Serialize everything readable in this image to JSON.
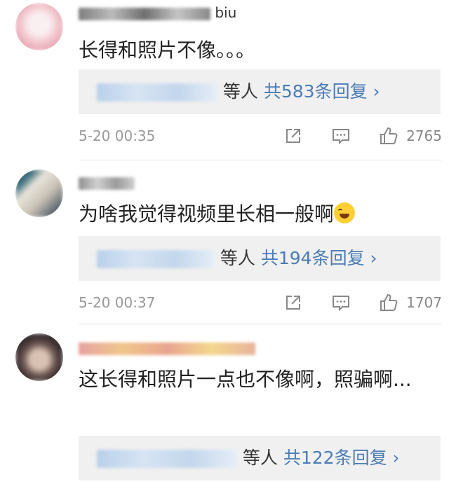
{
  "comments": [
    {
      "username_visible": "biu",
      "text": "长得和照片不像。。。",
      "replies_suffix": "等人",
      "replies_count": "共583条回复 ›",
      "time": "5-20 00:35",
      "likes": "2765"
    },
    {
      "username_visible": "",
      "text": "为啥我觉得视频里长相一般啊",
      "replies_suffix": "等人",
      "replies_count": "共194条回复 ›",
      "time": "5-20 00:37",
      "likes": "1707"
    },
    {
      "username_visible": "",
      "text": "这长得和照片一点也不像啊，照骗啊...",
      "replies_suffix": "等人",
      "replies_count": "共122条回复 ›",
      "time": "",
      "likes": ""
    }
  ],
  "icons": {
    "share": "share-icon",
    "comment": "comment-icon",
    "like": "thumbs-up-icon",
    "emoji": "laughing-tears-emoji"
  },
  "colors": {
    "link": "#4a7cb5",
    "reply_bg": "#f0f0f0",
    "meta": "#999999"
  }
}
